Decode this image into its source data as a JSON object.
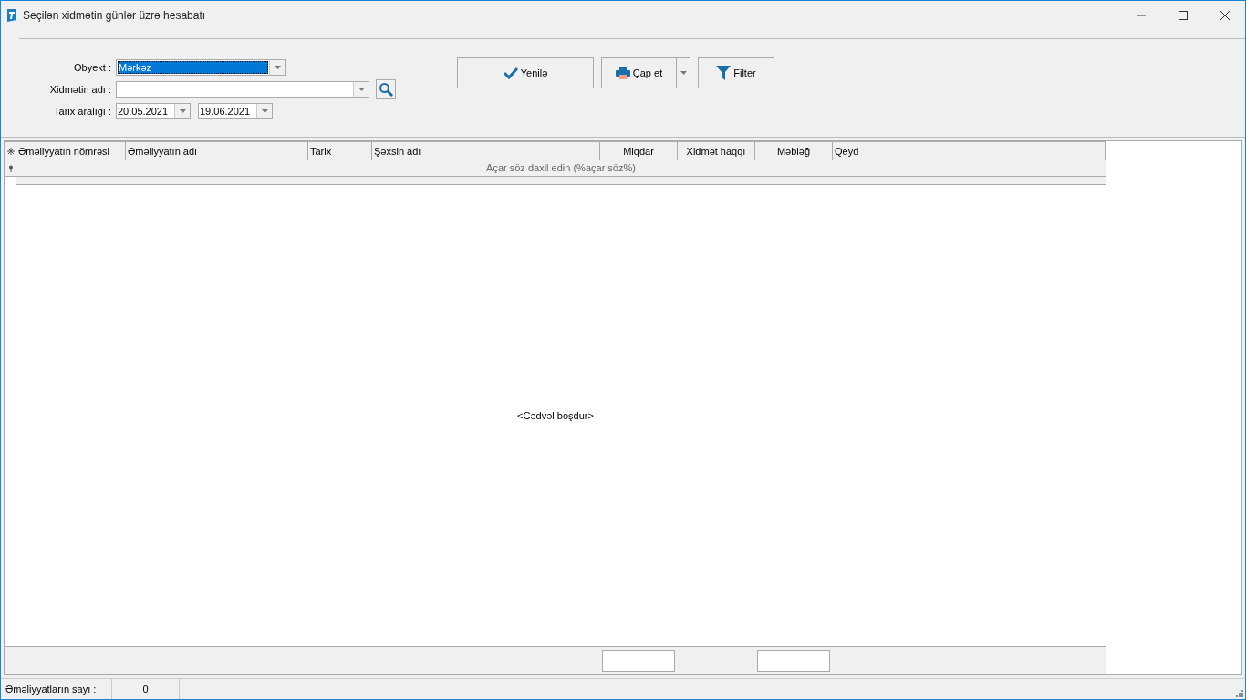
{
  "window": {
    "title": "Seçilən xidmətin günlər üzrə hesabatı"
  },
  "form": {
    "fields": [
      {
        "label": "Obyekt :",
        "value": "Mərkəz",
        "selected": true,
        "search": false
      },
      {
        "label": "Xidmətin adı :",
        "search": true
      }
    ],
    "date_range": {
      "label": "Tarix aralığı :",
      "from": "20.05.2021",
      "to": "19.06.2021"
    }
  },
  "buttons": [
    {
      "label": "Yenilə",
      "kind": "refresh",
      "dropdown": false
    },
    {
      "label": "Çap et",
      "kind": "print",
      "dropdown": true
    },
    {
      "label": "Filter",
      "kind": "filter",
      "dropdown": false
    }
  ],
  "table": {
    "columns": [
      {
        "label": "Əməliyyatın nömrəsi",
        "kind": "text"
      },
      {
        "label": "Əməliyyatın adı",
        "kind": "text"
      },
      {
        "label": "Tarix",
        "kind": "text"
      },
      {
        "label": "Şəxsin adı",
        "kind": "text"
      },
      {
        "label": "Miqdar",
        "kind": "numeric",
        "summary": true
      },
      {
        "label": "Xidmət haqqı",
        "kind": "numeric"
      },
      {
        "label": "Məbləğ",
        "kind": "numeric",
        "summary": true
      },
      {
        "label": "Qeyd",
        "kind": "text"
      }
    ],
    "filter_placeholder": "Açar söz daxil edin (%açar söz%)",
    "empty_text": "<Cədvəl boşdur>"
  },
  "status_bar": {
    "label": "Əməliyyatların sayı :",
    "value": "0"
  }
}
